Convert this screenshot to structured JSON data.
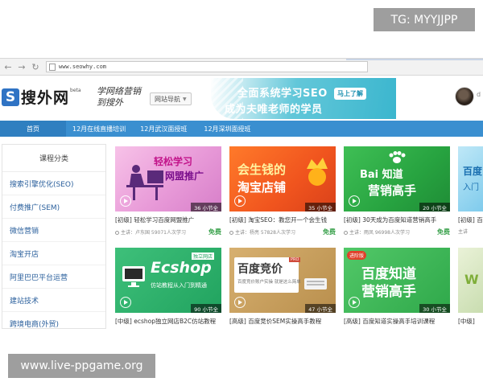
{
  "watermark_top": "TG: MYYJJPP",
  "watermark_bottom": "www.live-ppgame.org",
  "browser": {
    "back_icon": "arrow-left-icon",
    "forward_icon": "arrow-right-icon",
    "reload_icon": "reload-icon",
    "url": "www.seowhy.com"
  },
  "header": {
    "logo_mark": "S",
    "logo_text": "搜外网",
    "logo_beta": "beta",
    "slogan": "学网络营销 到搜外",
    "site_nav": "网站导航",
    "banner_line1": "全面系统学习SEO",
    "banner_line2": "成为夫唯老师的学员",
    "banner_cta": "马上了解",
    "avatar_tail": "d"
  },
  "nav": {
    "items": [
      "首页",
      "12月在线直播培训",
      "12月武汉面授班",
      "12月深圳面授班"
    ]
  },
  "sidebar": {
    "title": "课程分类",
    "items": [
      "搜索引擎优化(SEO)",
      "付费推广(SEM)",
      "微信营销",
      "淘宝开店",
      "阿里巴巴平台运营",
      "建站技术",
      "跨境电商(外贸)"
    ]
  },
  "cards": [
    {
      "headline": "轻松学习",
      "sub": "网盟推广",
      "lessons": "36 小节全",
      "title": "[初级] 轻松学习百度网盟推广",
      "meta": "主讲：卢东国 59071人次学习",
      "free": "免费"
    },
    {
      "headline": "会生钱的",
      "sub": "淘宝店铺",
      "lessons": "35 小节全",
      "title": "[初级] 淘宝SEO：教您开一个会生钱",
      "meta": "主讲：杨亮 57828人次学习",
      "free": "免费"
    },
    {
      "headline": "Bai 知道",
      "sub": "营销高手",
      "lessons": "20 小节全",
      "title": "[初级] 30天成为百度知道营销高手",
      "meta": "主讲：雨凤 96998人次学习",
      "free": "免费"
    },
    {
      "headline": "百度",
      "sub": "入门",
      "lessons": "",
      "title": "[初级] 百",
      "meta": "主讲",
      "free": ""
    },
    {
      "headline": "Ecshop",
      "sub": "仿站教程从入门到精通",
      "badge": "独立网店",
      "lessons": "90 小节全",
      "title": "[中级] ecshop独立网店B2C仿站教程",
      "meta": "",
      "free": ""
    },
    {
      "headline": "百度竞价",
      "sub": "百度竞价账户实操 就是这么简单",
      "badge": "PRO",
      "lessons": "47 小节全",
      "title": "[高级] 百度竞价SEM实操高手教程",
      "meta": "",
      "free": ""
    },
    {
      "headline": "百度知道",
      "sub": "营销高手",
      "badge": "进阶版",
      "lessons": "30 小节全",
      "title": "[高级] 百度知道实操高手培训课程",
      "meta": "",
      "free": ""
    },
    {
      "headline": "W",
      "sub": "",
      "lessons": "",
      "title": "[中级]",
      "meta": "",
      "free": ""
    }
  ],
  "colors": {
    "nav_blue": "#3a8fd0",
    "logo_blue": "#2f73c4",
    "free_green": "#3aa14c",
    "banner_teal": "#3bb6ce"
  }
}
